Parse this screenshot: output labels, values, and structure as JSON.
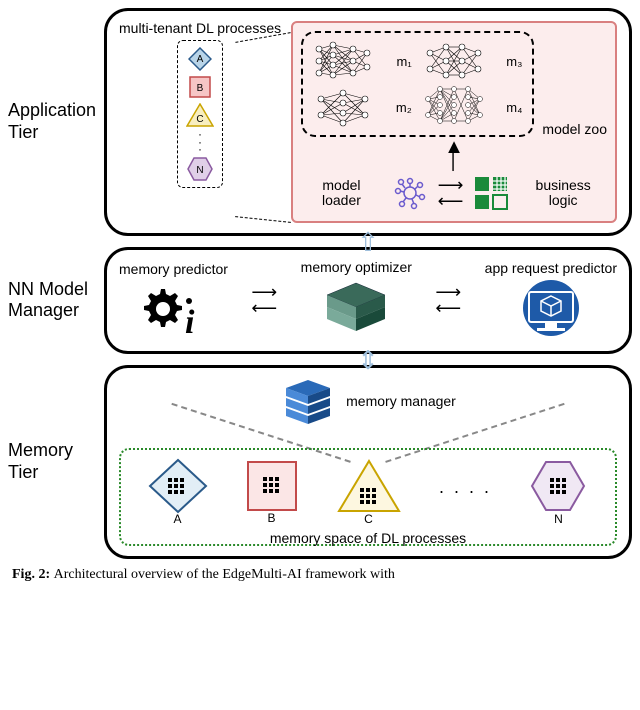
{
  "tiers": {
    "application": {
      "label": "Application Tier",
      "tenants_label": "multi-tenant DL processes",
      "tenants": [
        "A",
        "B",
        "C",
        "N"
      ],
      "model_zoo_label": "model zoo",
      "models": [
        "m₁",
        "m₂",
        "m₃",
        "m₄"
      ],
      "loader_label": "model loader",
      "business_logic_label": "business logic"
    },
    "nn": {
      "label": "NN Model Manager",
      "predictor_label": "memory predictor",
      "optimizer_label": "memory optimizer",
      "app_predictor_label": "app request predictor"
    },
    "memory": {
      "label": "Memory Tier",
      "manager_label": "memory manager",
      "space_caption": "memory space of DL processes",
      "processes": [
        "A",
        "B",
        "C",
        "N"
      ]
    }
  },
  "shapes": {
    "A": {
      "kind": "diamond",
      "fill": "#b8d4e8",
      "stroke": "#2a5a8a"
    },
    "B": {
      "kind": "square",
      "fill": "#f6c6c6",
      "stroke": "#c24a4a"
    },
    "C": {
      "kind": "triangle",
      "fill": "#f8eec0",
      "stroke": "#c9a400"
    },
    "N": {
      "kind": "hexagon",
      "fill": "#e0cfe8",
      "stroke": "#8a5aa0"
    }
  },
  "icons": {
    "neural_net": "neural-net-icon",
    "gear_info": "gear-info-icon",
    "stack": "server-stack-icon",
    "monitor_cube": "monitor-cube-icon",
    "brain_chip": "brain-chip-icon",
    "blocks": "business-blocks-icon",
    "db_stack": "db-stack-icon"
  },
  "colors": {
    "highlight_border": "#d98080",
    "highlight_fill": "#f5caca",
    "connector_arrow": "#9fbfdc",
    "mem_box_border": "#2a8a2a",
    "biz_green": "#1a8a3a",
    "db_blue": "#1e5aa8",
    "monitor_blue": "#1e5aa8",
    "loader_purple": "#6a5acd"
  },
  "caption_prefix": "Fig. 2: ",
  "caption_rest": "Architectural overview of the EdgeMulti-AI framework with"
}
